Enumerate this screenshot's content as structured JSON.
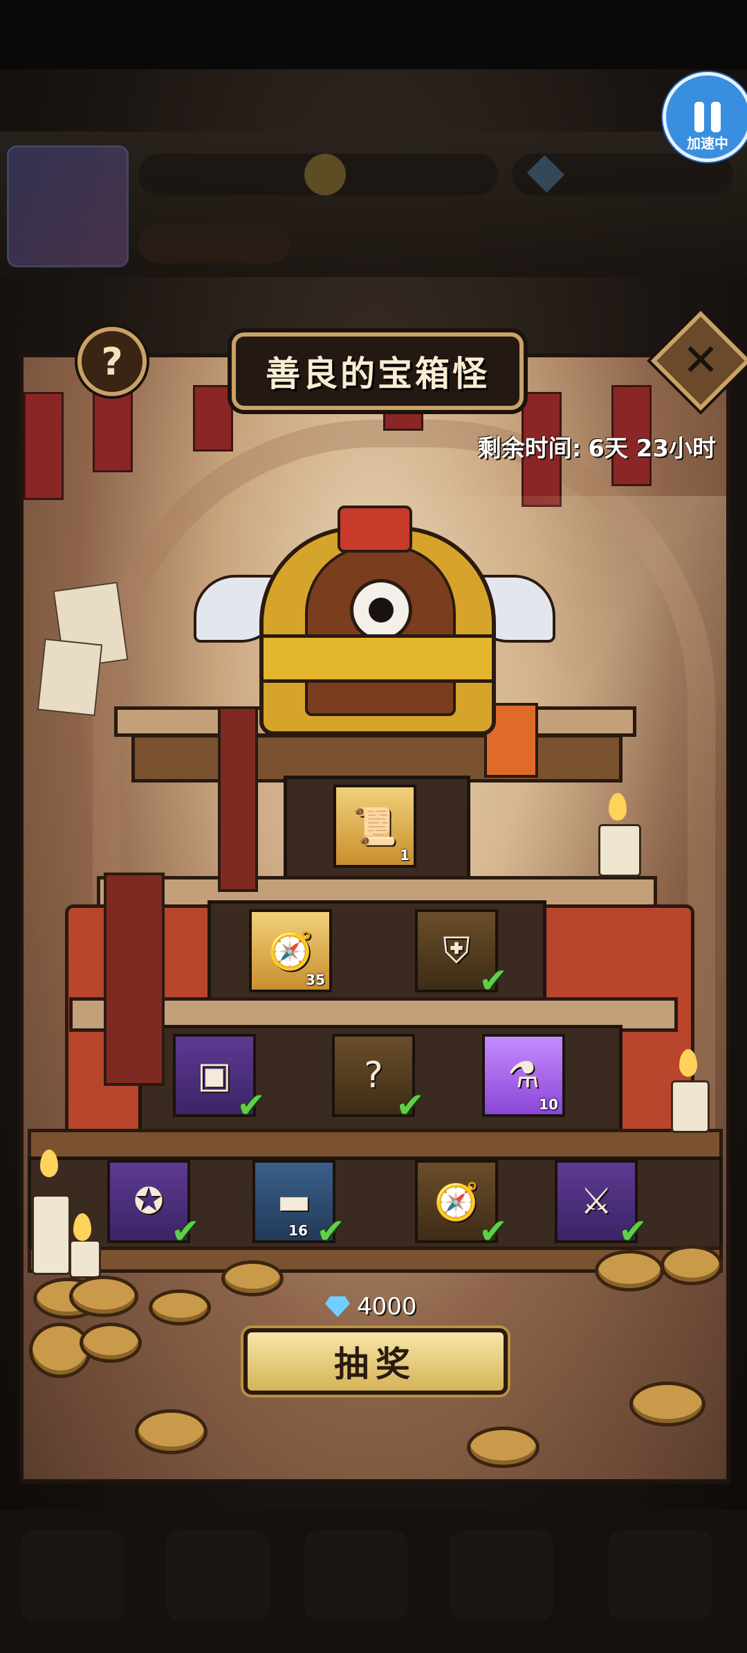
{
  "status_indicator": {
    "label": "加速中"
  },
  "modal": {
    "title": "善良的宝箱怪",
    "help_label": "?",
    "close_label": "✕",
    "timer_label": "剩余时间:",
    "timer_value": "6天 23小时"
  },
  "rewards": [
    {
      "row": 1,
      "icon": "scroll-icon",
      "rarity": "gold",
      "qty": "1",
      "claimed": false
    },
    {
      "row": 2,
      "icon": "compass-icon",
      "rarity": "gold",
      "qty": "35",
      "claimed": false
    },
    {
      "row": 2,
      "icon": "cloak-icon",
      "rarity": "dark",
      "qty": "",
      "claimed": true
    },
    {
      "row": 3,
      "icon": "box-icon",
      "rarity": "purple",
      "qty": "",
      "claimed": true
    },
    {
      "row": 3,
      "icon": "mystery-icon",
      "rarity": "dark",
      "qty": "",
      "claimed": true
    },
    {
      "row": 3,
      "icon": "potion-icon",
      "rarity": "bright",
      "qty": "10",
      "claimed": false
    },
    {
      "row": 4,
      "icon": "amulet-icon",
      "rarity": "purple",
      "qty": "",
      "claimed": true
    },
    {
      "row": 4,
      "icon": "ingot-icon",
      "rarity": "blue",
      "qty": "16",
      "claimed": true
    },
    {
      "row": 4,
      "icon": "compass-icon",
      "rarity": "dark",
      "qty": "",
      "claimed": true
    },
    {
      "row": 4,
      "icon": "bow-icon",
      "rarity": "purple",
      "qty": "",
      "claimed": true
    }
  ],
  "draw": {
    "cost": "4000",
    "button_label": "抽奖"
  },
  "colors": {
    "speed_badge": "#3a8ee0",
    "claimed_check": "#5fcf4a",
    "title_plate": "#241812"
  }
}
